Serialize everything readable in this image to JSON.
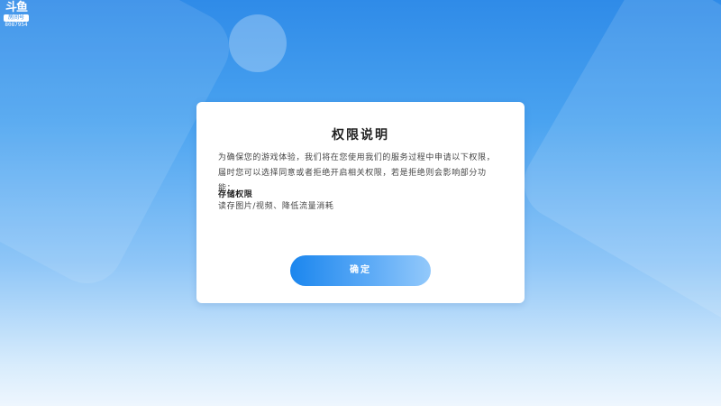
{
  "watermark": {
    "logo": "斗鱼",
    "tag": "房间号",
    "room": "8087954"
  },
  "dialog": {
    "title": "权限说明",
    "description": "为确保您的游戏体验，我们将在您使用我们的服务过程中申请以下权限，届时您可以选择同意或者拒绝开启相关权限，若是拒绝则会影响部分功能：",
    "permission": {
      "title": "存储权限",
      "description": "读存图片/视频、降低流量消耗"
    },
    "confirm_label": "确定"
  },
  "colors": {
    "background_top": "#2f8be8",
    "background_bottom": "#eef6fe",
    "button_start": "#1b86ee",
    "button_end": "#93c9fb"
  }
}
